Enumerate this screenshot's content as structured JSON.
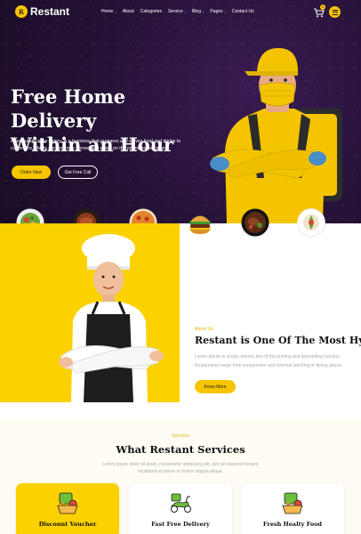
{
  "nav": {
    "brand": "Restant",
    "brand_mark": "R",
    "menu": [
      {
        "label": "Home",
        "caret": "›"
      },
      {
        "label": "About",
        "caret": ""
      },
      {
        "label": "Categories",
        "caret": ""
      },
      {
        "label": "Service",
        "caret": "›"
      },
      {
        "label": "Blog",
        "caret": "›"
      },
      {
        "label": "Pages",
        "caret": "›"
      },
      {
        "label": "Contact Us",
        "caret": ""
      }
    ],
    "cart_count": "0",
    "cart_icon": "cart-icon",
    "menu_icon": "hamburger-icon"
  },
  "hero": {
    "title_line1": "Free Home Delivery",
    "title_line2": "Within an Hour",
    "description": "A restaurant or an eatery, is a business that prepares and serves food and drinks to customers. Meals are generally served and eaten on the premises, but many.",
    "order_label": "Order Now",
    "call_label": "Get Free Call"
  },
  "food_icons": [
    "salad-plate-icon",
    "steak-plate-icon",
    "pizza-icon",
    "burger-icon",
    "grilled-meat-icon",
    "dessert-plate-icon"
  ],
  "about": {
    "tag": "About Us",
    "title": "Restant is One Of The Most Hygienic",
    "line1": "Lorem Ipsum is simply dummy text of the printing and typesetting industry.",
    "line2": "Restaurants range from inexpensive and informal lunching or dining places",
    "button": "Know More"
  },
  "services": {
    "tag": "Services",
    "title": "What Restant Services",
    "desc_line1": "Lorem ipsum dolor sit amet, consectetur adipiscing elit, sed do eiusmod tempor",
    "desc_line2": "incididunt ut labore et dolore magna aliqua.",
    "cards": [
      {
        "title": "Discount Voucher",
        "icon": "veggie-basket-icon"
      },
      {
        "title": "Fast Free Delivery",
        "icon": "scooter-icon"
      },
      {
        "title": "Fresh Healty Food",
        "icon": "veggie-basket-icon"
      }
    ]
  },
  "colors": {
    "accent": "#fbd200",
    "hero_bg": "#251236",
    "tag": "#e2b400"
  }
}
